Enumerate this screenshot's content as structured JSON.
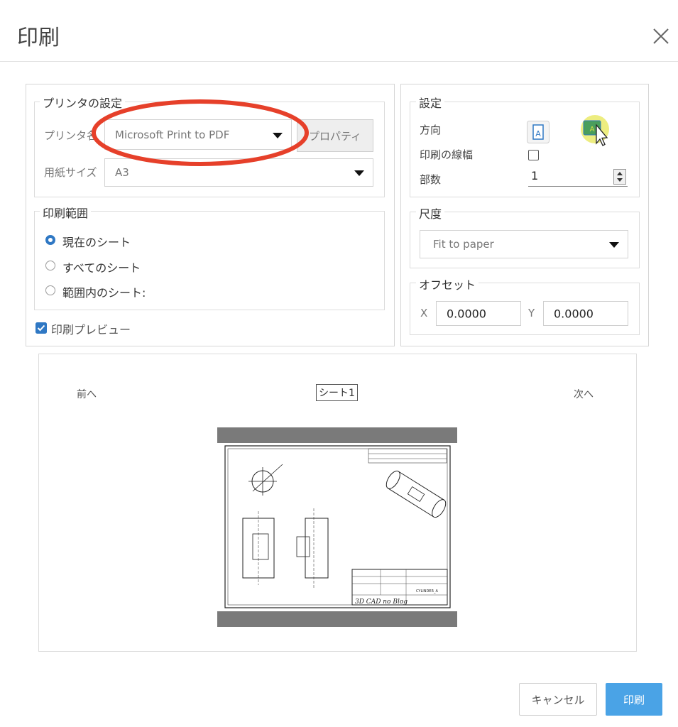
{
  "dialog": {
    "title": "印刷",
    "close_icon": "close-icon"
  },
  "printer_settings": {
    "legend": "プリンタの設定",
    "printer_label": "プリンタ名",
    "printer_value": "Microsoft Print to PDF",
    "properties_button": "プロパティ",
    "paper_label": "用紙サイズ",
    "paper_value": "A3"
  },
  "print_range": {
    "legend": "印刷範囲",
    "options": [
      "現在のシート",
      "すべてのシート",
      "範囲内のシート:"
    ],
    "selected": "現在のシート"
  },
  "preview_checkbox": {
    "label": "印刷プレビュー",
    "checked": true
  },
  "settings": {
    "legend": "設定",
    "orientation_label": "方向",
    "line_width_label": "印刷の線幅",
    "line_width_checked": false,
    "copies_label": "部数",
    "copies_value": "1"
  },
  "scale": {
    "legend": "尺度",
    "value": "Fit to paper"
  },
  "offset": {
    "legend": "オフセット",
    "x_label": "X",
    "x_value": "0.0000",
    "y_label": "Y",
    "y_value": "0.0000"
  },
  "preview": {
    "prev_label": "前へ",
    "sheet_label": "シート1",
    "next_label": "次へ",
    "title_block_text": "3D CAD no Blog",
    "part_name": "CYLINDER_A"
  },
  "footer": {
    "cancel_label": "キャンセル",
    "print_label": "印刷"
  },
  "colors": {
    "accent": "#4aa3e6",
    "radio": "#2f78c4",
    "highlight_circle": "#e6402a"
  }
}
